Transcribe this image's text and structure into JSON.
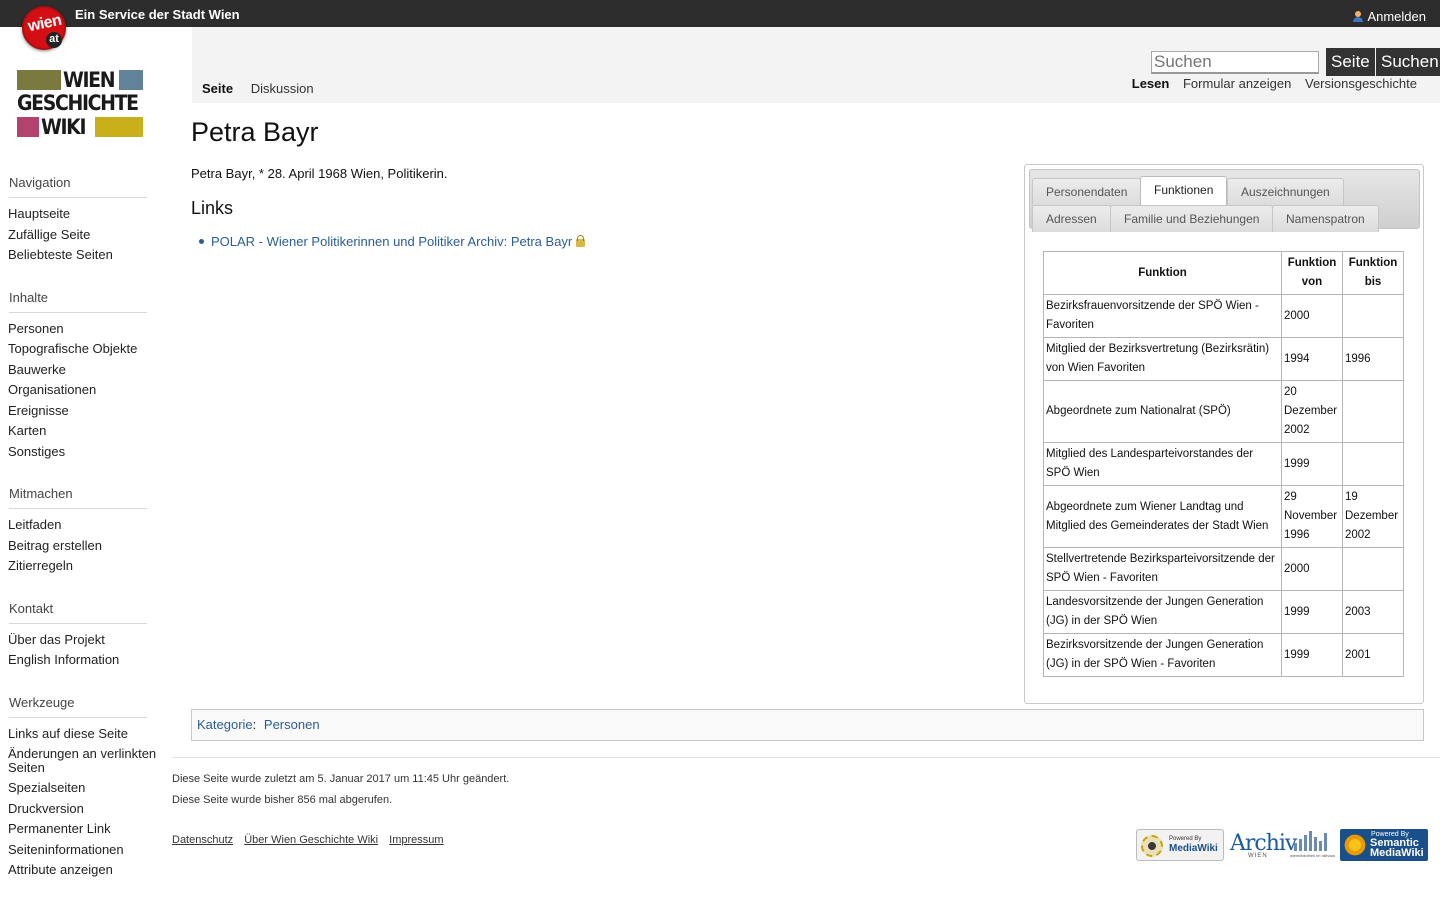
{
  "topbar": {
    "logo_text_1": "wien",
    "logo_text_2": "at",
    "service_text": "Ein Service der Stadt Wien",
    "login_label": "Anmelden"
  },
  "logo": {
    "line1": "WIEN",
    "line2": "GESCHICHTE",
    "line3": "WIKI",
    "colors": [
      "#7a7a3e",
      "#62829a",
      "#b4426f",
      "#c9b01a"
    ]
  },
  "sidebar": {
    "sections": [
      {
        "title": "Navigation",
        "items": [
          "Hauptseite",
          "Zufällige Seite",
          "Beliebteste Seiten"
        ]
      },
      {
        "title": "Inhalte",
        "items": [
          "Personen",
          "Topografische Objekte",
          "Bauwerke",
          "Organisationen",
          "Ereignisse",
          "Karten",
          "Sonstiges"
        ]
      },
      {
        "title": "Mitmachen",
        "items": [
          "Leitfaden",
          "Beitrag erstellen",
          "Zitierregeln"
        ]
      },
      {
        "title": "Kontakt",
        "items": [
          "Über das Projekt",
          "English Information"
        ]
      },
      {
        "title": "Werkzeuge",
        "items": [
          "Links auf diese Seite",
          "Änderungen an verlinkten Seiten",
          "Spezialseiten",
          "Druckversion",
          "Permanenter Link",
          "Seiteninformationen",
          "Attribute anzeigen"
        ]
      }
    ]
  },
  "header": {
    "tab_page": "Seite",
    "tab_discussion": "Diskussion",
    "search_placeholder": "Suchen",
    "go_button": "Seite",
    "search_button": "Suchen",
    "view_read": "Lesen",
    "view_form": "Formular anzeigen",
    "view_history": "Versionsgeschichte"
  },
  "content": {
    "title": "Petra Bayr",
    "intro": "Petra Bayr, * 28. April 1968 Wien, Politikerin.",
    "links_heading": "Links",
    "links": [
      "POLAR - Wiener Politikerinnen und Politiker Archiv: Petra Bayr"
    ]
  },
  "infobox": {
    "tabs_row1": [
      "Personendaten",
      "Funktionen",
      "Auszeichnungen"
    ],
    "tabs_row2": [
      "Adressen",
      "Familie und Beziehungen",
      "Namenspatron"
    ],
    "active_tab": "Funktionen",
    "table": {
      "headers": [
        "Funktion",
        "Funktion von",
        "Funktion bis"
      ],
      "rows": [
        [
          "Bezirksfrauenvorsitzende der SPÖ Wien - Favoriten",
          "2000",
          ""
        ],
        [
          "Mitglied der Bezirksvertretung (Bezirksrätin) von Wien Favoriten",
          "1994",
          "1996"
        ],
        [
          "Abgeordnete zum Nationalrat (SPÖ)",
          "20 Dezember 2002",
          ""
        ],
        [
          "Mitglied des Landesparteivorstandes der SPÖ Wien",
          "1999",
          ""
        ],
        [
          "Abgeordnete zum Wiener Landtag und Mitglied des Gemeinderates der Stadt Wien",
          "29 November 1996",
          "19 Dezember 2002"
        ],
        [
          "Stellvertretende Bezirksparteivorsitzende der SPÖ Wien - Favoriten",
          "2000",
          ""
        ],
        [
          "Landesvorsitzende der Jungen Generation (JG) in der SPÖ Wien",
          "1999",
          "2003"
        ],
        [
          "Bezirksvorsitzende der Jungen Generation (JG) in der SPÖ Wien - Favoriten",
          "1999",
          "2001"
        ]
      ]
    }
  },
  "category": {
    "label": "Kategorie",
    "value": "Personen"
  },
  "footer": {
    "last_modified": "Diese Seite wurde zuletzt am 5. Januar 2017 um 11:45 Uhr geändert.",
    "views": "Diese Seite wurde bisher 856 mal abgerufen.",
    "links": [
      "Datenschutz",
      "Über Wien Geschichte Wiki",
      "Impressum"
    ],
    "badges": {
      "mediawiki_1": "Powered By",
      "mediawiki_2": "MediaWiki",
      "archiv_1": "Archiv",
      "archiv_2": "WIEN",
      "wb": "wienbibliothek im rathaus",
      "smw_1": "Powered By",
      "smw_2": "Semantic MediaWiki"
    }
  }
}
